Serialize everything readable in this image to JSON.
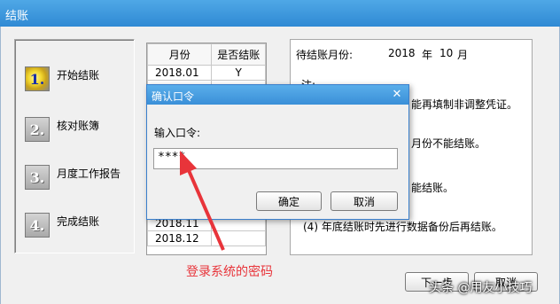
{
  "window": {
    "title": "结账"
  },
  "steps": [
    {
      "num": "1.",
      "label": "开始结账"
    },
    {
      "num": "2.",
      "label": "核对账簿"
    },
    {
      "num": "3.",
      "label": "月度工作报告"
    },
    {
      "num": "4.",
      "label": "完成结账"
    }
  ],
  "month_table": {
    "headers": [
      "月份",
      "是否结账"
    ],
    "rows": [
      [
        "2018.01",
        "Y"
      ],
      [
        "2018.11",
        ""
      ],
      [
        "2018.12",
        ""
      ]
    ]
  },
  "info": {
    "pending_label": "待结账月份:",
    "year": "2018",
    "year_unit": "年",
    "month": "10",
    "month_unit": "月",
    "note_label": "注:",
    "line1": "能再填制非调整凭证。",
    "line2": "月份不能结账。",
    "line3": "能结账。",
    "line4": "(4) 年底结账时先进行数据备份后再结账。"
  },
  "buttons": {
    "next": "下一步",
    "cancel": "取消"
  },
  "dialog": {
    "title": "确认口令",
    "close": "✕",
    "prompt": "输入口令:",
    "password_value": "****",
    "ok": "确定",
    "cancel": "取消"
  },
  "annotation": {
    "text": "登录系统的密码",
    "color": "#e8343a"
  },
  "watermark": {
    "text": "头条 @用友小技巧"
  }
}
